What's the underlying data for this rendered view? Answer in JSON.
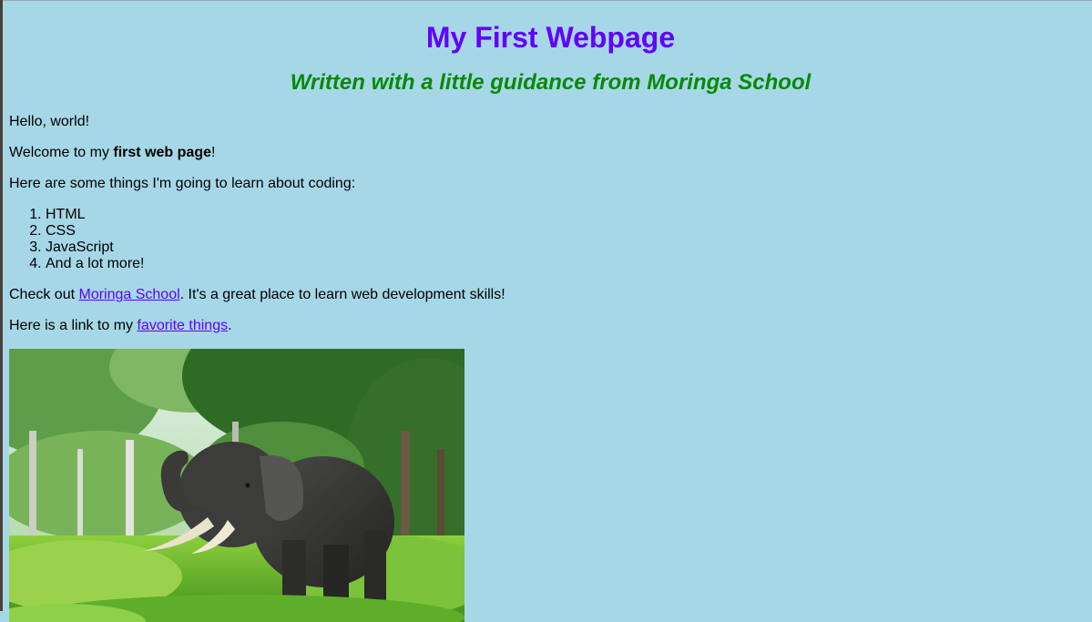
{
  "header": {
    "title": "My First Webpage",
    "subtitle": "Written with a little guidance from Moringa School"
  },
  "content": {
    "hello": "Hello, world!",
    "welcome_prefix": "Welcome to my ",
    "welcome_bold": "first web page",
    "welcome_suffix": "!",
    "learn_intro": "Here are some things I'm going to learn about coding:",
    "learn_list": [
      "HTML",
      "CSS",
      "JavaScript",
      "And a lot more!"
    ],
    "check_prefix": "Check out ",
    "check_link": "Moringa School",
    "check_suffix": ". It's a great place to learn web development skills!",
    "fav_prefix": "Here is a link to my ",
    "fav_link": "favorite things",
    "fav_suffix": "."
  },
  "image": {
    "icon": "elephant-photo"
  },
  "colors": {
    "background": "#a6d7e7",
    "title": "#6200ff",
    "subtitle": "#078a07",
    "link": "#6200ff"
  }
}
